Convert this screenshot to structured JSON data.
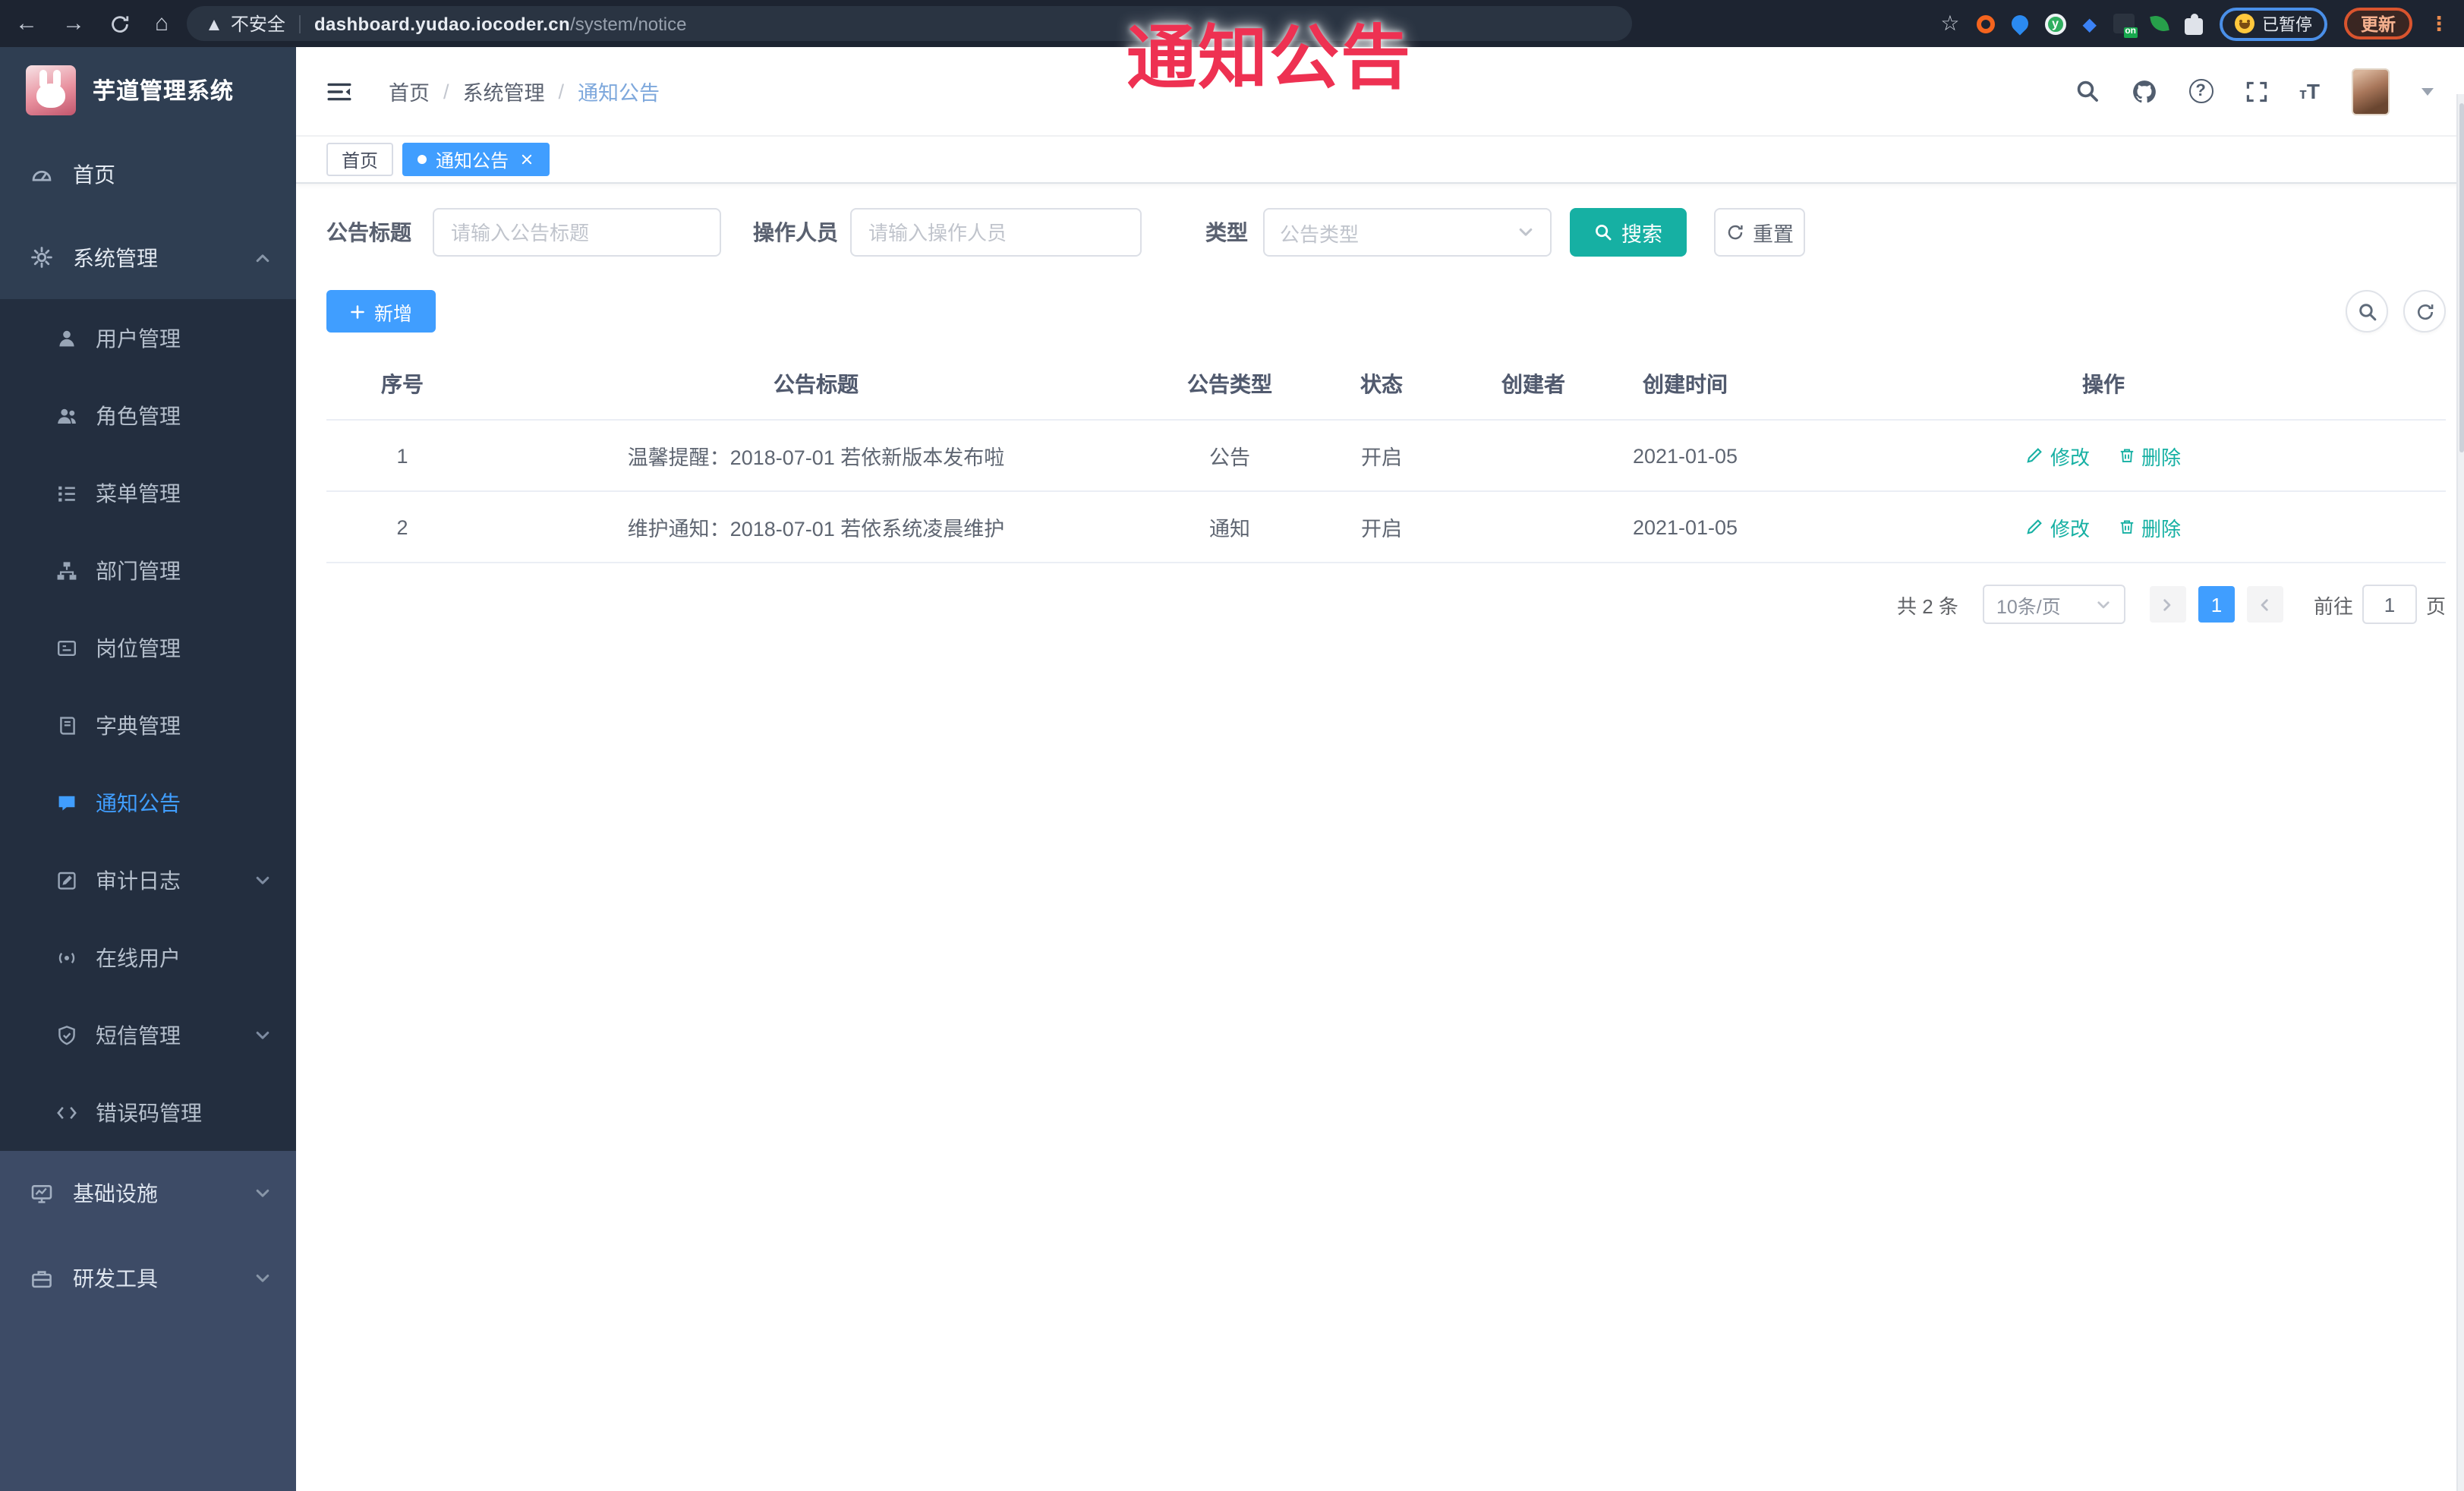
{
  "watermark": {
    "text": "通知公告",
    "color": "#ee3152"
  },
  "browser": {
    "security_label": "不安全",
    "url_domain": "dashboard.yudao.iocoder.cn",
    "url_path": "/system/notice",
    "extension_badge": "on",
    "extension_letter": "y",
    "profile_status": "已暂停",
    "update_label": "更新"
  },
  "app": {
    "title": "芋道管理系统"
  },
  "breadcrumb": {
    "items": [
      "首页",
      "系统管理",
      "通知公告"
    ]
  },
  "tabs": {
    "home": "首页",
    "current": "通知公告"
  },
  "sidebar": {
    "items": [
      {
        "label": "首页"
      },
      {
        "label": "系统管理"
      },
      {
        "label": "用户管理"
      },
      {
        "label": "角色管理"
      },
      {
        "label": "菜单管理"
      },
      {
        "label": "部门管理"
      },
      {
        "label": "岗位管理"
      },
      {
        "label": "字典管理"
      },
      {
        "label": "通知公告"
      },
      {
        "label": "审计日志"
      },
      {
        "label": "在线用户"
      },
      {
        "label": "短信管理"
      },
      {
        "label": "错误码管理"
      },
      {
        "label": "基础设施"
      },
      {
        "label": "研发工具"
      }
    ]
  },
  "filters": {
    "title_label": "公告标题",
    "title_placeholder": "请输入公告标题",
    "operator_label": "操作人员",
    "operator_placeholder": "请输入操作人员",
    "type_label": "类型",
    "type_placeholder": "公告类型",
    "search_label": "搜索",
    "reset_label": "重置"
  },
  "toolbar": {
    "add_label": "新增"
  },
  "table": {
    "columns": [
      "序号",
      "公告标题",
      "公告类型",
      "状态",
      "创建者",
      "创建时间",
      "操作"
    ],
    "rows": [
      {
        "index": "1",
        "title": "温馨提醒：2018-07-01 若依新版本发布啦",
        "type": "公告",
        "status": "开启",
        "creator": "",
        "create_time": "2021-01-05"
      },
      {
        "index": "2",
        "title": "维护通知：2018-07-01 若依系统凌晨维护",
        "type": "通知",
        "status": "开启",
        "creator": "",
        "create_time": "2021-01-05"
      }
    ],
    "edit_label": "修改",
    "delete_label": "删除"
  },
  "pagination": {
    "total": "共 2 条",
    "page_size": "10条/页",
    "page": "1",
    "goto": "前往",
    "unit": "页",
    "goto_value": "1"
  },
  "colors": {
    "accent": "#409eff",
    "teal": "#16b0a3",
    "watermark": "#ee3152",
    "sidebar_bg": "#2f3e52",
    "submenu_bg": "#232e3f",
    "sidebar_bottom_bg": "#3d4b66",
    "browser_bar_bg": "#1d2431"
  }
}
